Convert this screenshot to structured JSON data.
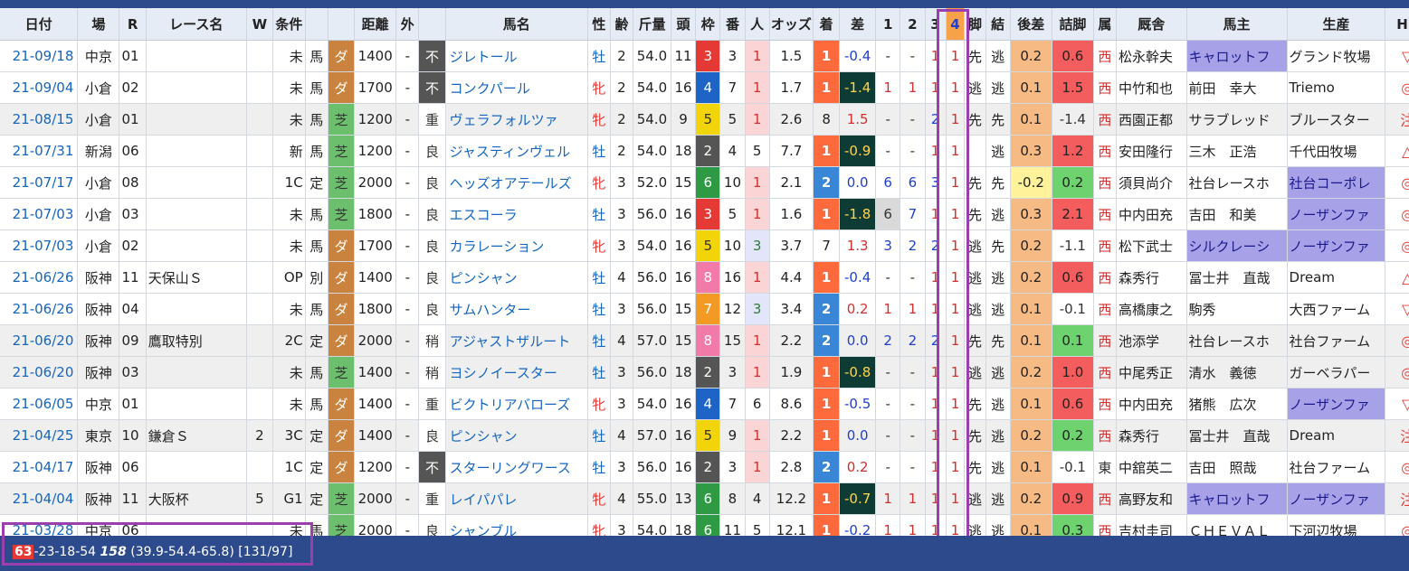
{
  "headers": [
    "日付",
    "場",
    "R",
    "レース名",
    "W",
    "条件",
    "",
    "",
    "距離",
    "外",
    "",
    "馬名",
    "性",
    "齢",
    "斤量",
    "頭",
    "枠",
    "番",
    "人",
    "オッズ",
    "着",
    "差",
    "1",
    "2",
    "3",
    "4",
    "脚",
    "結",
    "後差",
    "詰脚",
    "属",
    "厩舎",
    "馬主",
    "生産",
    "HB"
  ],
  "rows": [
    {
      "date": "21-09/18",
      "place": "中京",
      "r": "01",
      "race": "",
      "w": "",
      "cls": "未",
      "cond": "馬",
      "surf": "ダ",
      "dist": "1400",
      "out": "-",
      "track": "不",
      "horse": "ジレトール",
      "sex": "牡",
      "age": "2",
      "wt": "54.0",
      "n": "11",
      "waku": "3",
      "ban": "3",
      "pop": "1",
      "odds": "1.5",
      "fin": "1",
      "diff": "-0.4",
      "c1": "-",
      "c2": "-",
      "c3": "1",
      "c4": "1",
      "kyaku": "先",
      "res": "逃",
      "atosa": "0.2",
      "tsume": "0.6",
      "zoku": "西",
      "stable": "松永幹夫",
      "owner": "キャロットフ",
      "breeder": "グランド牧場",
      "hb": "▽"
    },
    {
      "date": "21-09/04",
      "place": "小倉",
      "r": "02",
      "race": "",
      "w": "",
      "cls": "未",
      "cond": "馬",
      "surf": "ダ",
      "dist": "1700",
      "out": "-",
      "track": "不",
      "horse": "コンクパール",
      "sex": "牝",
      "age": "2",
      "wt": "54.0",
      "n": "16",
      "waku": "4",
      "ban": "7",
      "pop": "1",
      "odds": "1.7",
      "fin": "1",
      "diff": "-1.4",
      "c1": "1",
      "c2": "1",
      "c3": "1",
      "c4": "1",
      "kyaku": "逃",
      "res": "逃",
      "atosa": "0.1",
      "tsume": "1.5",
      "zoku": "西",
      "stable": "中竹和也",
      "owner": "前田　幸大",
      "breeder": "Triemo",
      "hb": "◎"
    },
    {
      "date": "21-08/15",
      "place": "小倉",
      "r": "01",
      "race": "",
      "w": "",
      "cls": "未",
      "cond": "馬",
      "surf": "芝",
      "dist": "1200",
      "out": "-",
      "track": "重",
      "horse": "ヴェラフォルツァ",
      "sex": "牝",
      "age": "2",
      "wt": "54.0",
      "n": "9",
      "waku": "5",
      "ban": "5",
      "pop": "1",
      "odds": "2.6",
      "fin": "8",
      "diff": "1.5",
      "c1": "-",
      "c2": "-",
      "c3": "2",
      "c4": "1",
      "kyaku": "先",
      "res": "先",
      "atosa": "0.1",
      "tsume": "-1.4",
      "zoku": "西",
      "stable": "西園正都",
      "owner": "サラブレッド",
      "breeder": "ブルースター",
      "hb": "注"
    },
    {
      "date": "21-07/31",
      "place": "新潟",
      "r": "06",
      "race": "",
      "w": "",
      "cls": "新",
      "cond": "馬",
      "surf": "芝",
      "dist": "1200",
      "out": "-",
      "track": "良",
      "horse": "ジャスティンヴェル",
      "sex": "牡",
      "age": "2",
      "wt": "54.0",
      "n": "18",
      "waku": "2",
      "ban": "4",
      "pop": "5",
      "odds": "7.7",
      "fin": "1",
      "diff": "-0.9",
      "c1": "-",
      "c2": "-",
      "c3": "1",
      "c4": "1",
      "kyaku": "",
      "res": "逃",
      "atosa": "0.3",
      "tsume": "1.2",
      "zoku": "西",
      "stable": "安田隆行",
      "owner": "三木　正浩",
      "breeder": "千代田牧場",
      "hb": "△"
    },
    {
      "date": "21-07/17",
      "place": "小倉",
      "r": "08",
      "race": "",
      "w": "",
      "cls": "1C",
      "cond": "定",
      "surf": "芝",
      "dist": "2000",
      "out": "-",
      "track": "良",
      "horse": "ヘッズオアテールズ",
      "sex": "牝",
      "age": "3",
      "wt": "52.0",
      "n": "15",
      "waku": "6",
      "ban": "10",
      "pop": "1",
      "odds": "2.1",
      "fin": "2",
      "diff": "0.0",
      "c1": "6",
      "c2": "6",
      "c3": "3",
      "c4": "1",
      "kyaku": "先",
      "res": "先",
      "atosa": "-0.2",
      "tsume": "0.2",
      "zoku": "西",
      "stable": "須貝尚介",
      "owner": "社台レースホ",
      "breeder": "社台コーポレ",
      "hb": "◎"
    },
    {
      "date": "21-07/03",
      "place": "小倉",
      "r": "03",
      "race": "",
      "w": "",
      "cls": "未",
      "cond": "馬",
      "surf": "芝",
      "dist": "1800",
      "out": "-",
      "track": "良",
      "horse": "エスコーラ",
      "sex": "牡",
      "age": "3",
      "wt": "56.0",
      "n": "16",
      "waku": "3",
      "ban": "5",
      "pop": "1",
      "odds": "1.6",
      "fin": "1",
      "diff": "-1.8",
      "c1": "6",
      "c2": "7",
      "c3": "1",
      "c4": "1",
      "kyaku": "先",
      "res": "逃",
      "atosa": "0.3",
      "tsume": "2.1",
      "zoku": "西",
      "stable": "中内田充",
      "owner": "吉田　和美",
      "breeder": "ノーザンファ",
      "hb": "◎"
    },
    {
      "date": "21-07/03",
      "place": "小倉",
      "r": "02",
      "race": "",
      "w": "",
      "cls": "未",
      "cond": "馬",
      "surf": "ダ",
      "dist": "1700",
      "out": "-",
      "track": "良",
      "horse": "カラレーション",
      "sex": "牝",
      "age": "3",
      "wt": "54.0",
      "n": "16",
      "waku": "5",
      "ban": "10",
      "pop": "3",
      "odds": "3.7",
      "fin": "7",
      "diff": "1.3",
      "c1": "3",
      "c2": "2",
      "c3": "2",
      "c4": "1",
      "kyaku": "逃",
      "res": "先",
      "atosa": "0.2",
      "tsume": "-1.1",
      "zoku": "西",
      "stable": "松下武士",
      "owner": "シルクレーシ",
      "breeder": "ノーザンファ",
      "hb": "◎"
    },
    {
      "date": "21-06/26",
      "place": "阪神",
      "r": "11",
      "race": "天保山Ｓ",
      "w": "",
      "cls": "OP",
      "cond": "別",
      "surf": "ダ",
      "dist": "1400",
      "out": "-",
      "track": "良",
      "horse": "ピンシャン",
      "sex": "牡",
      "age": "4",
      "wt": "56.0",
      "n": "16",
      "waku": "8",
      "ban": "16",
      "pop": "1",
      "odds": "4.4",
      "fin": "1",
      "diff": "-0.4",
      "c1": "-",
      "c2": "-",
      "c3": "1",
      "c4": "1",
      "kyaku": "逃",
      "res": "逃",
      "atosa": "0.2",
      "tsume": "0.6",
      "zoku": "西",
      "stable": "森秀行",
      "owner": "冨士井　直哉",
      "breeder": "Dream",
      "hb": "△"
    },
    {
      "date": "21-06/26",
      "place": "阪神",
      "r": "04",
      "race": "",
      "w": "",
      "cls": "未",
      "cond": "馬",
      "surf": "ダ",
      "dist": "1800",
      "out": "-",
      "track": "良",
      "horse": "サムハンター",
      "sex": "牡",
      "age": "3",
      "wt": "56.0",
      "n": "15",
      "waku": "7",
      "ban": "12",
      "pop": "3",
      "odds": "3.4",
      "fin": "2",
      "diff": "0.2",
      "c1": "1",
      "c2": "1",
      "c3": "1",
      "c4": "1",
      "kyaku": "逃",
      "res": "逃",
      "atosa": "0.1",
      "tsume": "-0.1",
      "zoku": "西",
      "stable": "高橋康之",
      "owner": "駒秀",
      "breeder": "大西ファーム",
      "hb": "▽"
    },
    {
      "date": "21-06/20",
      "place": "阪神",
      "r": "09",
      "race": "鷹取特別",
      "w": "",
      "cls": "2C",
      "cond": "定",
      "surf": "ダ",
      "dist": "2000",
      "out": "-",
      "track": "稍",
      "horse": "アジャストザルート",
      "sex": "牡",
      "age": "4",
      "wt": "57.0",
      "n": "15",
      "waku": "8",
      "ban": "15",
      "pop": "1",
      "odds": "2.2",
      "fin": "2",
      "diff": "0.0",
      "c1": "2",
      "c2": "2",
      "c3": "2",
      "c4": "1",
      "kyaku": "先",
      "res": "先",
      "atosa": "0.1",
      "tsume": "0.1",
      "zoku": "西",
      "stable": "池添学",
      "owner": "社台レースホ",
      "breeder": "社台ファーム",
      "hb": "◎"
    },
    {
      "date": "21-06/20",
      "place": "阪神",
      "r": "03",
      "race": "",
      "w": "",
      "cls": "未",
      "cond": "馬",
      "surf": "芝",
      "dist": "1400",
      "out": "-",
      "track": "稍",
      "horse": "ヨシノイースター",
      "sex": "牡",
      "age": "3",
      "wt": "56.0",
      "n": "18",
      "waku": "2",
      "ban": "3",
      "pop": "1",
      "odds": "1.9",
      "fin": "1",
      "diff": "-0.8",
      "c1": "-",
      "c2": "-",
      "c3": "1",
      "c4": "1",
      "kyaku": "逃",
      "res": "逃",
      "atosa": "0.2",
      "tsume": "1.0",
      "zoku": "西",
      "stable": "中尾秀正",
      "owner": "清水　義徳",
      "breeder": "ガーベラパー",
      "hb": "◎"
    },
    {
      "date": "21-06/05",
      "place": "中京",
      "r": "01",
      "race": "",
      "w": "",
      "cls": "未",
      "cond": "馬",
      "surf": "ダ",
      "dist": "1400",
      "out": "-",
      "track": "重",
      "horse": "ビクトリアバローズ",
      "sex": "牝",
      "age": "3",
      "wt": "54.0",
      "n": "16",
      "waku": "4",
      "ban": "7",
      "pop": "6",
      "odds": "8.6",
      "fin": "1",
      "diff": "-0.5",
      "c1": "-",
      "c2": "-",
      "c3": "1",
      "c4": "1",
      "kyaku": "先",
      "res": "逃",
      "atosa": "0.1",
      "tsume": "0.6",
      "zoku": "西",
      "stable": "中内田充",
      "owner": "猪熊　広次",
      "breeder": "ノーザンファ",
      "hb": "▽"
    },
    {
      "date": "21-04/25",
      "place": "東京",
      "r": "10",
      "race": "鎌倉Ｓ",
      "w": "2",
      "cls": "3C",
      "cond": "定",
      "surf": "ダ",
      "dist": "1400",
      "out": "-",
      "track": "良",
      "horse": "ピンシャン",
      "sex": "牡",
      "age": "4",
      "wt": "57.0",
      "n": "16",
      "waku": "5",
      "ban": "9",
      "pop": "1",
      "odds": "2.2",
      "fin": "1",
      "diff": "0.0",
      "c1": "-",
      "c2": "-",
      "c3": "1",
      "c4": "1",
      "kyaku": "先",
      "res": "逃",
      "atosa": "0.2",
      "tsume": "0.2",
      "zoku": "西",
      "stable": "森秀行",
      "owner": "冨士井　直哉",
      "breeder": "Dream",
      "hb": "注"
    },
    {
      "date": "21-04/17",
      "place": "阪神",
      "r": "06",
      "race": "",
      "w": "",
      "cls": "1C",
      "cond": "定",
      "surf": "ダ",
      "dist": "1200",
      "out": "-",
      "track": "不",
      "horse": "スターリングワース",
      "sex": "牡",
      "age": "3",
      "wt": "56.0",
      "n": "16",
      "waku": "2",
      "ban": "3",
      "pop": "1",
      "odds": "2.8",
      "fin": "2",
      "diff": "0.2",
      "c1": "-",
      "c2": "-",
      "c3": "1",
      "c4": "1",
      "kyaku": "先",
      "res": "逃",
      "atosa": "0.1",
      "tsume": "-0.1",
      "zoku": "東",
      "stable": "中舘英二",
      "owner": "吉田　照哉",
      "breeder": "社台ファーム",
      "hb": "◎"
    },
    {
      "date": "21-04/04",
      "place": "阪神",
      "r": "11",
      "race": "大阪杯",
      "w": "5",
      "cls": "G1",
      "cond": "定",
      "surf": "芝",
      "dist": "2000",
      "out": "-",
      "track": "重",
      "horse": "レイパパレ",
      "sex": "牝",
      "age": "4",
      "wt": "55.0",
      "n": "13",
      "waku": "6",
      "ban": "8",
      "pop": "4",
      "odds": "12.2",
      "fin": "1",
      "diff": "-0.7",
      "c1": "1",
      "c2": "1",
      "c3": "1",
      "c4": "1",
      "kyaku": "逃",
      "res": "逃",
      "atosa": "0.2",
      "tsume": "0.9",
      "zoku": "西",
      "stable": "高野友和",
      "owner": "キャロットフ",
      "breeder": "ノーザンファ",
      "hb": "注"
    },
    {
      "date": "21-03/28",
      "place": "中京",
      "r": "06",
      "race": "",
      "w": "",
      "cls": "未",
      "cond": "馬",
      "surf": "芝",
      "dist": "2000",
      "out": "-",
      "track": "良",
      "horse": "シャンブル",
      "sex": "牝",
      "age": "3",
      "wt": "54.0",
      "n": "18",
      "waku": "6",
      "ban": "11",
      "pop": "5",
      "odds": "12.1",
      "fin": "1",
      "diff": "-0.2",
      "c1": "1",
      "c2": "1",
      "c3": "1",
      "c4": "1",
      "kyaku": "逃",
      "res": "逃",
      "atosa": "0.1",
      "tsume": "0.3",
      "zoku": "西",
      "stable": "吉村圭司",
      "owner": "ＣＨＥＶＡＬ",
      "breeder": "下河辺牧場",
      "hb": "◎"
    }
  ],
  "summary": {
    "wins": "63",
    "record": "-23-18-54",
    "total": "158",
    "rates": "(39.9-54.4-65.8)",
    "counts": "[131/97]"
  }
}
